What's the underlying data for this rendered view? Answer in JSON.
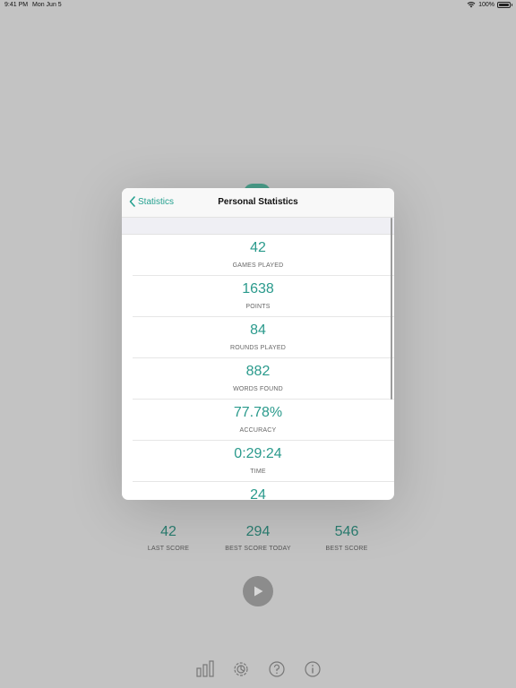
{
  "status_bar": {
    "time": "9:41 PM",
    "date": "Mon Jun 5",
    "battery": "100%"
  },
  "background": {
    "scores": [
      {
        "value": "42",
        "label": "LAST SCORE"
      },
      {
        "value": "294",
        "label": "BEST SCORE TODAY"
      },
      {
        "value": "546",
        "label": "BEST SCORE"
      }
    ],
    "toolbar": [
      "stats-icon",
      "settings-icon",
      "help-icon",
      "info-icon"
    ]
  },
  "modal": {
    "back_label": "Statistics",
    "title": "Personal Statistics",
    "rows": [
      {
        "value": "42",
        "label": "GAMES PLAYED"
      },
      {
        "value": "1638",
        "label": "POINTS"
      },
      {
        "value": "84",
        "label": "ROUNDS PLAYED"
      },
      {
        "value": "882",
        "label": "WORDS FOUND"
      },
      {
        "value": "77.78%",
        "label": "ACCURACY"
      },
      {
        "value": "0:29:24",
        "label": "TIME"
      },
      {
        "value": "24",
        "label": ""
      }
    ]
  },
  "colors": {
    "accent": "#2a9a8c",
    "back": "#24a08f"
  }
}
